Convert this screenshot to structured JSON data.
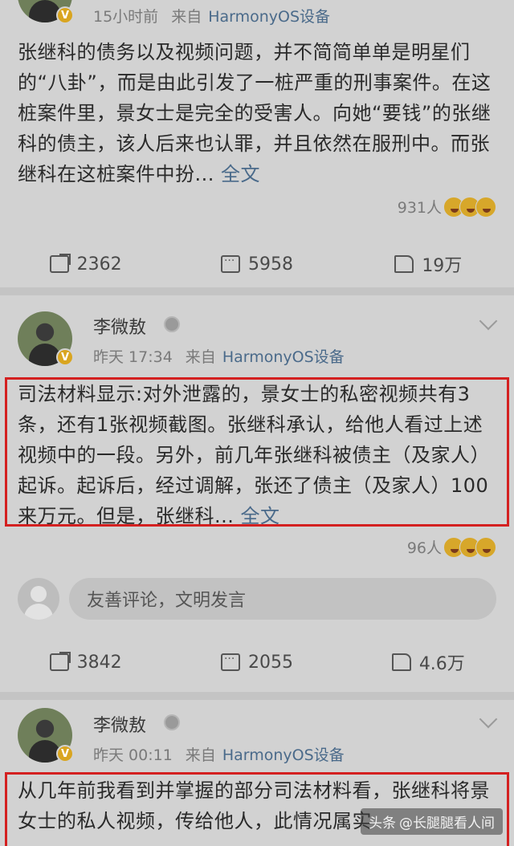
{
  "post1": {
    "timestamp": "15小时前",
    "source_label": "来自",
    "source": "HarmonyOS设备",
    "text": "张继科的债务以及视频问题，并不简简单单是明星们的“八卦”，而是由此引发了一桩严重的刑事案件。在这桩案件里，景女士是完全的受害人。向她“要钱”的张继科的债主，该人后来也认罪，并且依然在服刑中。而张继科在这桩案件中扮...",
    "more": "全文",
    "reaction_count": "931人",
    "share_count": "2362",
    "comment_count": "5958",
    "like_count": "19万"
  },
  "post2": {
    "username": "李微敖",
    "timestamp": "昨天 17:34",
    "source_label": "来自",
    "source": "HarmonyOS设备",
    "text": "司法材料显示:对外泄露的，景女士的私密视频共有3条，还有1张视频截图。张继科承认，给他人看过上述视频中的一段。另外，前几年张继科被债主（及家人）起诉。起诉后，经过调解，张还了债主（及家人）100来万元。但是，张继科...",
    "more": "全文",
    "reaction_count": "96人",
    "comment_placeholder": "友善评论，文明发言",
    "share_count": "3842",
    "comment_count": "2055",
    "like_count": "4.6万"
  },
  "post3": {
    "username": "李微敖",
    "timestamp": "昨天 00:11",
    "source_label": "来自",
    "source": "HarmonyOS设备",
    "text": "从几年前我看到并掌握的部分司法材料看，张继科将景女士的私人视频，传给他人，此情况属实"
  },
  "watermark": {
    "platform": "头条",
    "account": "@长腿腿看人间"
  },
  "colors": {
    "highlight_box": "#d42020",
    "link": "#4a6a8a"
  }
}
